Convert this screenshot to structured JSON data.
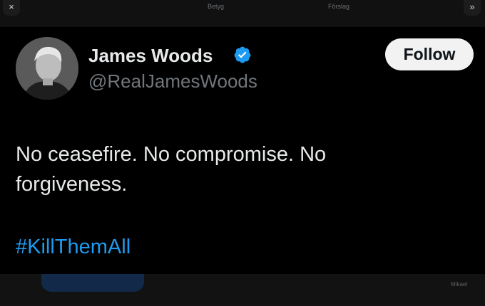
{
  "background": {
    "tabs": [
      "Betyg",
      "Förslag"
    ],
    "bottom_label": "Mikael"
  },
  "overlay": {
    "close_label": "×",
    "expand_label": "»"
  },
  "tweet": {
    "author": {
      "name": "James Woods",
      "handle": "@RealJamesWoods",
      "verified": true
    },
    "follow_label": "Follow",
    "text": "No ceasefire. No compromise. No forgiveness.",
    "hashtag": "#KillThemAll"
  },
  "colors": {
    "background": "#000000",
    "text": "#e7e9ea",
    "secondary": "#71767b",
    "link": "#1d9bf0",
    "follow_bg": "#f2f2f2"
  }
}
